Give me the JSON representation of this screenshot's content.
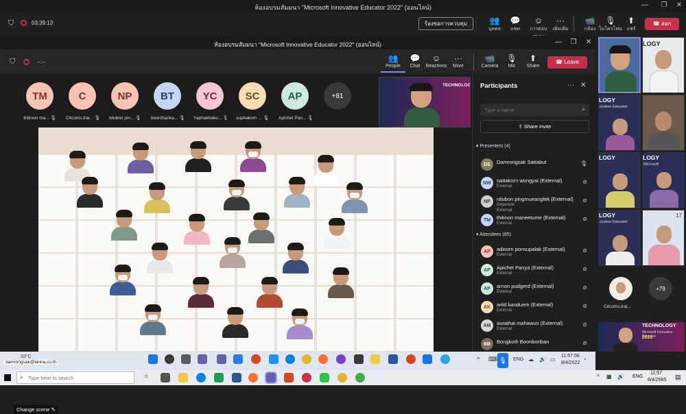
{
  "outer": {
    "title": "ห้องอบรมสัมมนา \"Microsoft Innovative Educator 2022\" (ออนไลน์)",
    "timer": "03:39:13",
    "request_control": "ร้องขอการควบคุม",
    "items": [
      {
        "label": "บุคคล",
        "icon": "people-icon"
      },
      {
        "label": "แชท",
        "icon": "chat-icon"
      },
      {
        "label": "การตอบสนอง",
        "icon": "reactions-icon"
      },
      {
        "label": "เพิ่มเติม",
        "icon": "more-icon"
      },
      {
        "label": "กล้อง",
        "icon": "camera-icon"
      },
      {
        "label": "ไมโครโฟน",
        "icon": "mic-off-icon"
      },
      {
        "label": "แชร์",
        "icon": "share-icon"
      }
    ],
    "leave_label": "ออก"
  },
  "inner": {
    "title": "ห้องอบรมสัมมนา \"Microsoft Innovative Educator 2022\" (ออนไลน์)",
    "timer": "--:--",
    "items": [
      {
        "label": "People",
        "icon": "people-icon"
      },
      {
        "label": "Chat",
        "icon": "chat-icon"
      },
      {
        "label": "Reactions",
        "icon": "reactions-icon"
      },
      {
        "label": "More",
        "icon": "more-icon"
      },
      {
        "label": "Camera",
        "icon": "camera-icon"
      },
      {
        "label": "Mic",
        "icon": "mic-icon"
      },
      {
        "label": "Share",
        "icon": "share-icon"
      }
    ],
    "leave_label": "Leave"
  },
  "stage": {
    "participants": [
      {
        "initials": "TM",
        "name": "thitinon ma...",
        "bg": "#f6c3b5",
        "fg": "#7a3526"
      },
      {
        "initials": "C",
        "name": "Citcoms.trai...",
        "bg": "#f6c3b5",
        "fg": "#7a3526"
      },
      {
        "initials": "NP",
        "name": "nilubon pin...",
        "bg": "#f6c3b5",
        "fg": "#7a3526"
      },
      {
        "initials": "BT",
        "name": "boontharika...",
        "bg": "#c6d6f2",
        "fg": "#253f72"
      },
      {
        "initials": "YC",
        "name": "Yaphakhako...",
        "bg": "#f3c6d8",
        "fg": "#7a2245"
      },
      {
        "initials": "SC",
        "name": "suphakorn ...",
        "bg": "#f8dcb4",
        "fg": "#7a4a10"
      },
      {
        "initials": "AP",
        "name": "Apichet Pan...",
        "bg": "#cdebdc",
        "fg": "#1f5d3e"
      }
    ],
    "overflow": "+81",
    "change_scene": "Change scene"
  },
  "panel": {
    "title": "Participants",
    "search_placeholder": "Type a name",
    "share_invite": "Share invite",
    "presenters_header": "Presenters (4)",
    "attendees_header": "Attendees (85)",
    "presenters": [
      {
        "initials": "DS",
        "name": "Damrongsak Sattabut",
        "role": "",
        "bg": "#8a7a60",
        "fg": "#fff",
        "mic": "mic-icon"
      },
      {
        "initials": "NW",
        "name": "nattakorn wongyai (External)",
        "role": "External",
        "bg": "#c6d6f2",
        "fg": "#253f72",
        "mic": "mic-off-icon"
      },
      {
        "initials": "NP",
        "name": "nilubon pingmueanglek (External)",
        "role": "Organizer",
        "role2": "External",
        "bg": "#cfcfcf",
        "fg": "#333",
        "mic": "mic-off-icon"
      },
      {
        "initials": "TM",
        "name": "thitinon maneetume (External)",
        "role": "External",
        "bg": "#c6d6f2",
        "fg": "#253f72",
        "mic": "mic-off-icon"
      }
    ],
    "attendees": [
      {
        "initials": "AP",
        "name": "adisorn ponsupalak (External)",
        "role": "External",
        "bg": "#f6c3b5",
        "fg": "#7a3526",
        "mic": "mic-off-icon"
      },
      {
        "initials": "AP",
        "name": "Apichet Panya (External)",
        "role": "External",
        "bg": "#cdebdc",
        "fg": "#1f5d3e",
        "mic": "mic-off-icon"
      },
      {
        "initials": "AP",
        "name": "arnon pudgerd (External)",
        "role": "External",
        "bg": "#cdebdc",
        "fg": "#1f5d3e",
        "mic": "mic-off-icon"
      },
      {
        "initials": "AK",
        "name": "artid kanduem (External)",
        "role": "External",
        "bg": "#f8dcb4",
        "fg": "#7a4a10",
        "mic": "mic-off-icon"
      },
      {
        "initials": "AM",
        "name": "aurathai mahawun (External)",
        "role": "External",
        "bg": "#d9d9d9",
        "fg": "#333",
        "mic": "mic-off-icon"
      },
      {
        "initials": "BB",
        "name": "Bongkoth Boonboriban",
        "role": "",
        "bg": "#7b6a5a",
        "fg": "#fff",
        "mic": "mic-off-icon"
      }
    ]
  },
  "gallery": {
    "tile_text": "LOGY",
    "tile_sub": "ovative Educator",
    "tile_ms": "Microsoft",
    "tile_num": "17",
    "person_name": "Citcoms.trai...",
    "overflow": "+79",
    "banner_title": "TECHNOLOGY",
    "banner_sub": "Microsoft Innovative Educator",
    "banner_year": "2022"
  },
  "teams_taskbar": {
    "email": "damrongsak@lanna.co.th",
    "temp": "33°C",
    "lang": "ENG",
    "time": "11:57:56",
    "date": "8/4/2022"
  },
  "windows_taskbar": {
    "search_placeholder": "Type here to search",
    "lang": "ENG",
    "time": "11:57",
    "date": "8/4/2565"
  }
}
